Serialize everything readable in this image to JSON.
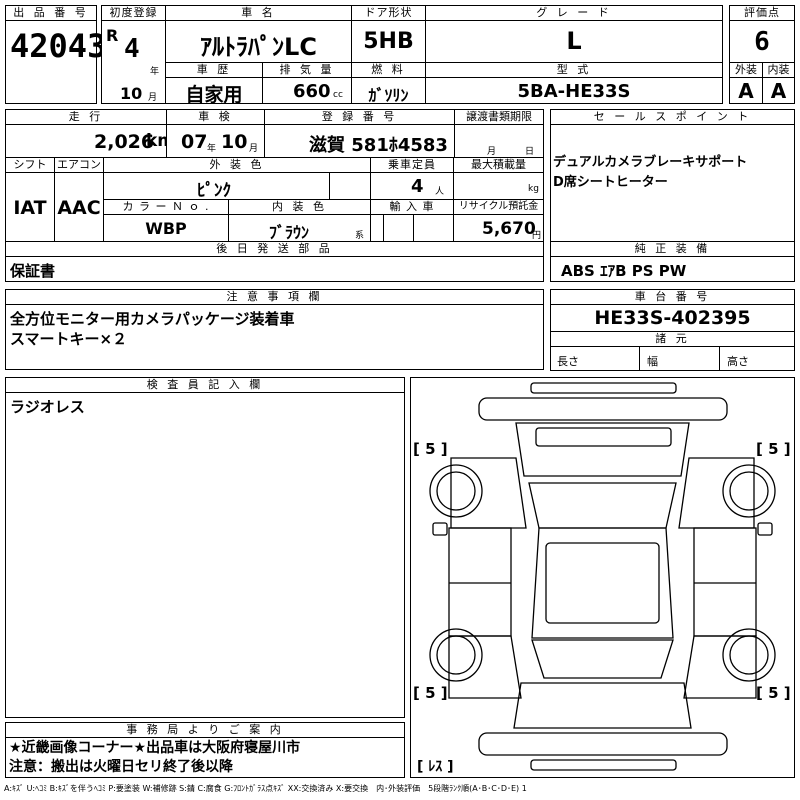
{
  "header": {
    "lot_label": "出 品 番 号",
    "lot_number": "42043",
    "first_reg_label": "初度登録",
    "era": "R",
    "year": "4",
    "year_unit": "年",
    "month": "10",
    "month_unit": "月",
    "car_name_label": "車 名",
    "car_name": "ｱﾙﾄﾗﾊﾟﾝLC",
    "door_label": "ドア形状",
    "door": "5HB",
    "grade_label": "グ レ ー ド",
    "grade": "L",
    "score_label": "評価点",
    "score": "6",
    "history_label": "車 歴",
    "history": "自家用",
    "displacement_label": "排 気 量",
    "displacement": "660",
    "displacement_unit": "cc",
    "fuel_label": "燃 料",
    "fuel": "ｶﾞｿﾘﾝ",
    "model_label": "型 式",
    "model": "5BA-HE33S",
    "exterior_label": "外装",
    "exterior": "A",
    "interior_label": "内装",
    "interior": "A"
  },
  "info": {
    "mileage_label": "走 行",
    "mileage": "2,026",
    "mileage_unit": "km",
    "inspection_label": "車 検",
    "inspection_year": "07",
    "inspection_year_unit": "年",
    "inspection_month": "10",
    "inspection_month_unit": "月",
    "plate_label": "登 録 番 号",
    "plate": "滋賀 581ﾎ4583",
    "transfer_label": "譲渡書類期限",
    "transfer_month_unit": "月",
    "transfer_day_unit": "日",
    "shift_label": "シフト",
    "shift": "IAT",
    "ac_label": "エアコン",
    "ac": "AAC",
    "color_label": "外 装 色",
    "color": "ﾋﾟﾝｸ",
    "capacity_label": "乗車定員",
    "capacity": "4",
    "capacity_unit": "人",
    "maxload_label": "最大積載量",
    "maxload_unit": "kg",
    "color_no_label": "カ ラ ー Ｎ ｏ .",
    "color_no": "WBP",
    "int_color_label": "内 装 色",
    "int_color": "ﾌﾞﾗｳﾝ",
    "int_color_unit": "系",
    "import_label": "輸 入 車",
    "recycle_label": "リサイクル預託金",
    "recycle": "5,670",
    "recycle_unit": "円",
    "later_parts_label": "後 日 発 送 部 品",
    "later_parts": "保証書"
  },
  "sales": {
    "label": "セ ー ル ス ポ イ ン ト",
    "text": "デュアルカメラブレーキサポート\nD席シートヒーター"
  },
  "equipment": {
    "label": "純 正 装 備",
    "text": "ABS ｴｱB PS PW"
  },
  "notes": {
    "label": "注 意 事 項 欄",
    "text": "全方位モニター用カメラパッケージ装着車\nスマートキー×２"
  },
  "chassis": {
    "label": "車 台 番 号",
    "number": "HE33S-402395",
    "specs_label": "諸 元",
    "length_label": "長さ",
    "width_label": "幅",
    "height_label": "高さ"
  },
  "inspector": {
    "label": "検 査 員 記 入 欄",
    "text": "ラジオレス"
  },
  "diagram": {
    "tire_tl": "[ 5 ]",
    "tire_tr": "[ 5 ]",
    "tire_bl": "[ 5 ]",
    "tire_br": "[ 5 ]",
    "spare": "[ ﾚｽ ]"
  },
  "office": {
    "label": "事 務 局 よ り ご 案 内",
    "text": "★近畿画像コーナー★出品車は大阪府寝屋川市\n注意：搬出は火曜日セリ終了後以降"
  },
  "legend": "A:ｷｽﾞ U:ﾍｺﾐ B:ｷｽﾞを伴うﾍｺﾐ P:要塗装 W:補修跡 S:錆 C:腐食 G:ﾌﾛﾝﾄｶﾞﾗｽ点ｷｽﾞ XX:交換済み X:要交換　内･外装評価　5段階ﾗﾝｸ順(A･B･C･D･E) 1"
}
